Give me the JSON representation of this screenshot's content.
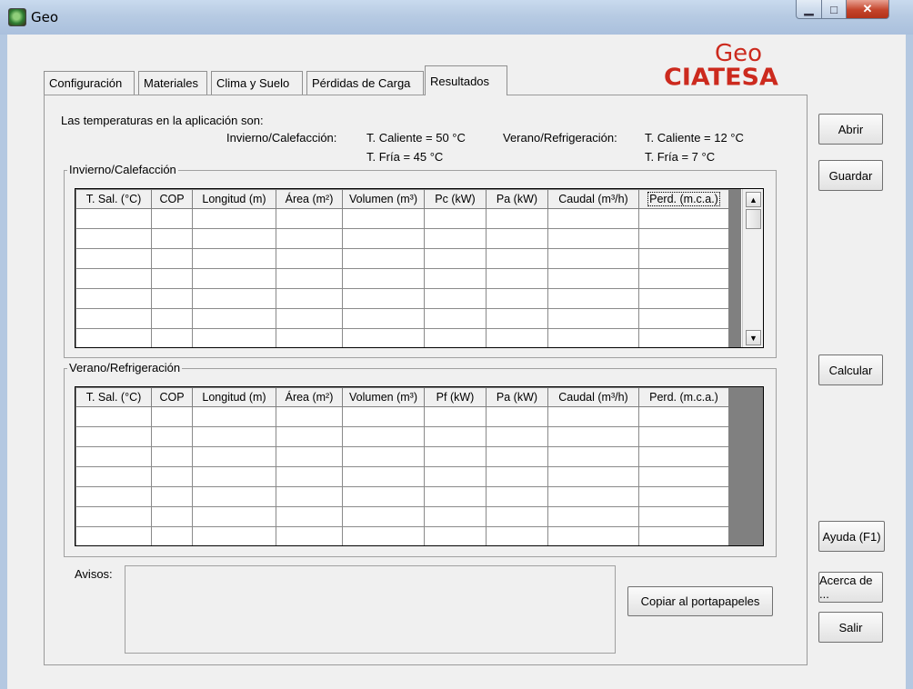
{
  "window": {
    "title": "Geo"
  },
  "logo": {
    "top": "Geo",
    "bottom": "CIATESA",
    "color": "#cc2a1e"
  },
  "tabs": [
    {
      "label": "Configuración",
      "active": false
    },
    {
      "label": "Materiales",
      "active": false
    },
    {
      "label": "Clima y Suelo",
      "active": false
    },
    {
      "label": "Pérdidas de Carga",
      "active": false
    },
    {
      "label": "Resultados",
      "active": true
    }
  ],
  "temps": {
    "intro": "Las temperaturas en la aplicación son:",
    "winter_label": "Invierno/Calefacción:",
    "winter_hot": "T. Caliente = 50 °C",
    "winter_cold": "T. Fría = 45 °C",
    "summer_label": "Verano/Refrigeración:",
    "summer_hot": "T. Caliente = 12 °C",
    "summer_cold": "T. Fría = 7 °C"
  },
  "winter": {
    "title": "Invierno/Calefacción",
    "columns": [
      "T. Sal. (°C)",
      "COP",
      "Longitud (m)",
      "Área (m²)",
      "Volumen (m³)",
      "Pc (kW)",
      "Pa (kW)",
      "Caudal (m³/h)",
      "Perd. (m.c.a.)"
    ]
  },
  "summer": {
    "title": "Verano/Refrigeración",
    "columns": [
      "T. Sal. (°C)",
      "COP",
      "Longitud (m)",
      "Área (m²)",
      "Volumen (m³)",
      "Pf (kW)",
      "Pa (kW)",
      "Caudal (m³/h)",
      "Perd. (m.c.a.)"
    ]
  },
  "avisos": {
    "label": "Avisos:",
    "value": ""
  },
  "buttons": {
    "abrir": "Abrir",
    "guardar": "Guardar",
    "calcular": "Calcular",
    "ayuda": "Ayuda (F1)",
    "acerca": "Acerca de ...",
    "salir": "Salir",
    "copiar": "Copiar al portapapeles"
  }
}
